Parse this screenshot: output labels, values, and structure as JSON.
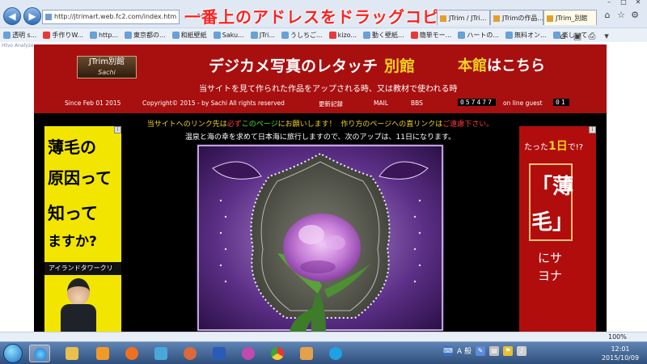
{
  "browser": {
    "url": "http://jtrimart.web.fc2.com/index.htm",
    "overlay_caption": "一番上のアドレスをドラッグコピー",
    "tabs": [
      "JTrim / JTri...",
      "JTrimの作品...",
      "JTrim_別館"
    ],
    "favorites": [
      "透明 s...",
      "手作りW...",
      "http...",
      "東京都の...",
      "和紙壁紙",
      "Saku...",
      "JTri...",
      "うしちご...",
      "kizo...",
      "動く壁紙...",
      "簡単モー...",
      "ハートの...",
      "無料オン...",
      "楽しいて..."
    ],
    "page_tag": "Htvo Analyze",
    "zoom": "100%"
  },
  "site": {
    "logo_line1": "JTrim別館",
    "logo_line2": "Sachi",
    "title": "デジカメ写真のレタッチ",
    "title_accent": "別館",
    "honkan_prefix": "本館",
    "honkan_suffix": "はこちら",
    "tagline": "当サイトを見て作られた作品をアップされる時、又は教材で使われる時",
    "since": "Since Feb 01 2015",
    "copyright": "Copyright© 2015 - by Sachi  All rights reserved",
    "nav": {
      "history": "更新記録",
      "mail": "MAIL",
      "bbs": "BBS"
    },
    "counter": "057477",
    "online_label": "on line guest",
    "online_count": "01",
    "notice1_a": "当サイトへのリンク先は",
    "notice1_b": "必ず",
    "notice1_c": "このページ",
    "notice1_d": "にお願いします！",
    "notice1_e": "作り方のページへの直リンクは",
    "notice1_f": "ご遠慮下さい。",
    "notice2": "温泉と海の幸を求めて日本海に旅行しますので、次のアップは、11日になります。"
  },
  "ads": {
    "left": {
      "lines": [
        "薄毛の",
        "原因って",
        "知って",
        "ますか?"
      ],
      "strip": "アイランドタワークリ"
    },
    "right": {
      "top_prefix": "たった",
      "top_big": "1日",
      "top_suffix": "で!?",
      "kanji": [
        "「薄",
        "毛」"
      ],
      "bottom": "にサヨナ"
    },
    "mark": "i"
  },
  "taskbar": {
    "time": "12:01",
    "date": "2015/10/09",
    "lang": "A 般"
  },
  "colors": {
    "header_red": "#a80f0f",
    "accent_yellow": "#f2d31c",
    "caption_red": "#ff2020"
  }
}
